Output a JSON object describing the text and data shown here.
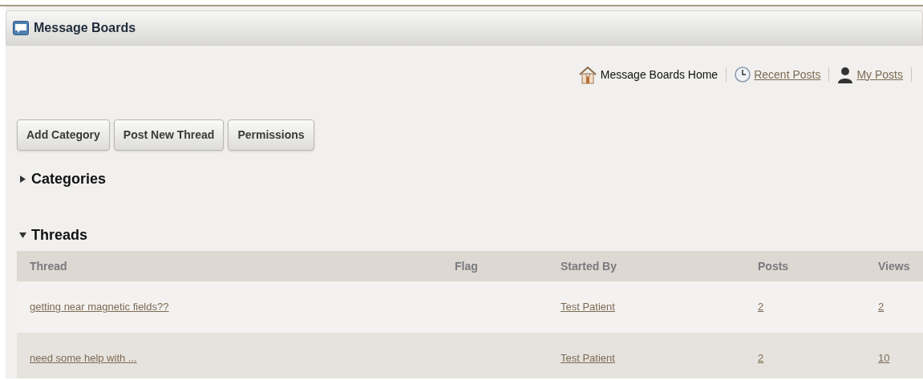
{
  "portlet": {
    "title": "Message Boards"
  },
  "nav": [
    {
      "kind": "home",
      "label": "Message Boards Home",
      "selected": true
    },
    {
      "kind": "recent",
      "label": "Recent Posts",
      "selected": false
    },
    {
      "kind": "mine",
      "label": "My Posts",
      "selected": false
    }
  ],
  "buttons": [
    "Add Category",
    "Post New Thread",
    "Permissions"
  ],
  "sections": [
    {
      "title": "Categories",
      "expanded": false
    },
    {
      "title": "Threads",
      "expanded": true
    }
  ],
  "table": {
    "columns": [
      "Thread",
      "Flag",
      "Started By",
      "Posts",
      "Views"
    ],
    "rows": [
      {
        "thread": "getting near magnetic fields??",
        "started_by": "Test Patient",
        "posts": "2",
        "views": "2"
      },
      {
        "thread": "need some help with ...",
        "started_by": "Test Patient",
        "posts": "2",
        "views": "10"
      }
    ]
  }
}
